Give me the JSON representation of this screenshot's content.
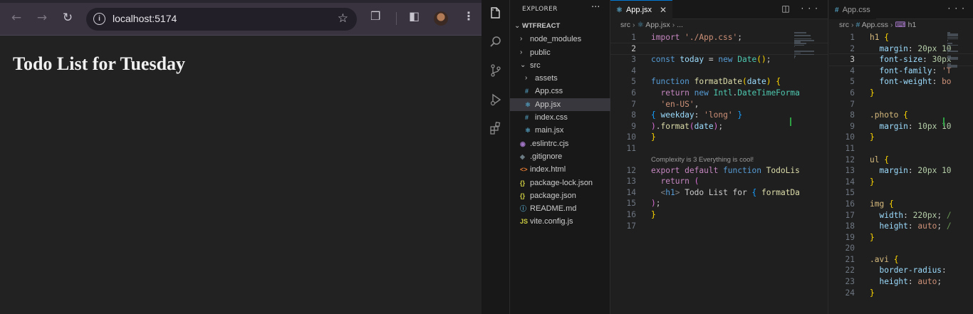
{
  "browser": {
    "url": "localhost:5174",
    "page_heading": "Todo List for Tuesday"
  },
  "vscode": {
    "explorer": {
      "title": "EXPLORER",
      "more": "···",
      "project": "WTFREACT",
      "items": [
        {
          "label": "node_modules",
          "kind": "folder-closed",
          "indent": 1
        },
        {
          "label": "public",
          "kind": "folder-closed",
          "indent": 1
        },
        {
          "label": "src",
          "kind": "folder-open",
          "indent": 1
        },
        {
          "label": "assets",
          "kind": "folder-closed",
          "indent": 2
        },
        {
          "label": "App.css",
          "kind": "css",
          "indent": 2
        },
        {
          "label": "App.jsx",
          "kind": "jsx",
          "indent": 2,
          "selected": true
        },
        {
          "label": "index.css",
          "kind": "css",
          "indent": 2
        },
        {
          "label": "main.jsx",
          "kind": "jsx",
          "indent": 2
        },
        {
          "label": ".eslintrc.cjs",
          "kind": "eslint",
          "indent": 1
        },
        {
          "label": ".gitignore",
          "kind": "git",
          "indent": 1
        },
        {
          "label": "index.html",
          "kind": "html",
          "indent": 1
        },
        {
          "label": "package-lock.json",
          "kind": "json",
          "indent": 1
        },
        {
          "label": "package.json",
          "kind": "json",
          "indent": 1
        },
        {
          "label": "README.md",
          "kind": "info",
          "indent": 1
        },
        {
          "label": "vite.config.js",
          "kind": "js",
          "indent": 1
        }
      ]
    },
    "editor_left": {
      "tab": "App.jsx",
      "breadcrumb": [
        "src",
        "App.jsx",
        "..."
      ],
      "codelens": "Complexity is 3 Everything is cool!",
      "lines": [
        {
          "n": "1",
          "segs": [
            [
              "k-kw",
              "import "
            ],
            [
              "k-str",
              "'./App.css'"
            ],
            [
              "k-plain",
              ";"
            ]
          ]
        },
        {
          "n": "2",
          "segs": [],
          "current": true
        },
        {
          "n": "3",
          "segs": [
            [
              "k-blue",
              "const "
            ],
            [
              "k-var",
              "today"
            ],
            [
              "k-plain",
              " = "
            ],
            [
              "k-blue",
              "new "
            ],
            [
              "k-cls",
              "Date"
            ],
            [
              "k-br1",
              "()"
            ],
            [
              "k-plain",
              ";"
            ]
          ]
        },
        {
          "n": "4",
          "segs": []
        },
        {
          "n": "5",
          "segs": [
            [
              "k-blue",
              "function "
            ],
            [
              "k-fn",
              "formatDate"
            ],
            [
              "k-br1",
              "("
            ],
            [
              "k-var",
              "date"
            ],
            [
              "k-br1",
              ")"
            ],
            [
              "k-plain",
              " "
            ],
            [
              "k-br1",
              "{"
            ]
          ]
        },
        {
          "n": "6",
          "segs": [
            [
              "k-plain",
              "  "
            ],
            [
              "k-kw",
              "return "
            ],
            [
              "k-blue",
              "new "
            ],
            [
              "k-cls",
              "Intl"
            ],
            [
              "k-plain",
              "."
            ],
            [
              "k-cls",
              "DateTimeForma"
            ]
          ]
        },
        {
          "n": "7",
          "segs": [
            [
              "k-plain",
              "  "
            ],
            [
              "k-str",
              "'en-US'"
            ],
            [
              "k-plain",
              ","
            ]
          ]
        },
        {
          "n": "8",
          "segs": [
            [
              "k-br3",
              "{"
            ],
            [
              "k-plain",
              " "
            ],
            [
              "k-var",
              "weekday"
            ],
            [
              "k-plain",
              ": "
            ],
            [
              "k-str",
              "'long'"
            ],
            [
              "k-plain",
              " "
            ],
            [
              "k-br3",
              "}"
            ]
          ]
        },
        {
          "n": "9",
          "segs": [
            [
              "k-br2",
              ")"
            ],
            [
              "k-plain",
              "."
            ],
            [
              "k-fn",
              "format"
            ],
            [
              "k-br2",
              "("
            ],
            [
              "k-var",
              "date"
            ],
            [
              "k-br2",
              ")"
            ],
            [
              "k-plain",
              ";"
            ]
          ]
        },
        {
          "n": "10",
          "segs": [
            [
              "k-br1",
              "}"
            ]
          ]
        },
        {
          "n": "11",
          "segs": []
        },
        {
          "n": "",
          "lens": true
        },
        {
          "n": "12",
          "segs": [
            [
              "k-kw",
              "export "
            ],
            [
              "k-kw",
              "default "
            ],
            [
              "k-blue",
              "function "
            ],
            [
              "k-fn",
              "TodoLis"
            ]
          ]
        },
        {
          "n": "13",
          "segs": [
            [
              "k-plain",
              "  "
            ],
            [
              "k-kw",
              "return "
            ],
            [
              "k-br2",
              "("
            ]
          ]
        },
        {
          "n": "14",
          "segs": [
            [
              "k-plain",
              "  "
            ],
            [
              "k-tag",
              "<"
            ],
            [
              "k-tagn",
              "h1"
            ],
            [
              "k-tag",
              ">"
            ],
            [
              "k-plain",
              " Todo List for "
            ],
            [
              "k-br3",
              "{"
            ],
            [
              "k-plain",
              " "
            ],
            [
              "k-fn",
              "formatDa"
            ]
          ]
        },
        {
          "n": "15",
          "segs": [
            [
              "k-br2",
              ")"
            ],
            [
              "k-plain",
              ";"
            ]
          ]
        },
        {
          "n": "16",
          "segs": [
            [
              "k-br1",
              "}"
            ]
          ]
        },
        {
          "n": "17",
          "segs": []
        }
      ]
    },
    "editor_right": {
      "tab": "App.css",
      "breadcrumb": [
        "src",
        "App.css",
        "h1"
      ],
      "lines": [
        {
          "n": "1",
          "segs": [
            [
              "k-sel",
              "h1 "
            ],
            [
              "k-br1",
              "{"
            ]
          ]
        },
        {
          "n": "2",
          "segs": [
            [
              "k-plain",
              "  "
            ],
            [
              "k-prop",
              "margin"
            ],
            [
              "k-plain",
              ": "
            ],
            [
              "k-num",
              "20px 10"
            ]
          ]
        },
        {
          "n": "3",
          "segs": [
            [
              "k-plain",
              "  "
            ],
            [
              "k-prop",
              "font-size"
            ],
            [
              "k-plain",
              ": "
            ],
            [
              "k-num",
              "30px"
            ]
          ],
          "current": true
        },
        {
          "n": "4",
          "segs": [
            [
              "k-plain",
              "  "
            ],
            [
              "k-prop",
              "font-family"
            ],
            [
              "k-plain",
              ": "
            ],
            [
              "k-str",
              "'T"
            ]
          ]
        },
        {
          "n": "5",
          "segs": [
            [
              "k-plain",
              "  "
            ],
            [
              "k-prop",
              "font-weight"
            ],
            [
              "k-plain",
              ": "
            ],
            [
              "k-str",
              "bo"
            ]
          ]
        },
        {
          "n": "6",
          "segs": [
            [
              "k-br1",
              "}"
            ]
          ]
        },
        {
          "n": "7",
          "segs": []
        },
        {
          "n": "8",
          "segs": [
            [
              "k-sel",
              ".photo "
            ],
            [
              "k-br1",
              "{"
            ]
          ]
        },
        {
          "n": "9",
          "segs": [
            [
              "k-plain",
              "  "
            ],
            [
              "k-prop",
              "margin"
            ],
            [
              "k-plain",
              ": "
            ],
            [
              "k-num",
              "10px 10"
            ]
          ]
        },
        {
          "n": "10",
          "segs": [
            [
              "k-br1",
              "}"
            ]
          ]
        },
        {
          "n": "11",
          "segs": []
        },
        {
          "n": "12",
          "segs": [
            [
              "k-sel",
              "ul "
            ],
            [
              "k-br1",
              "{"
            ]
          ]
        },
        {
          "n": "13",
          "segs": [
            [
              "k-plain",
              "  "
            ],
            [
              "k-prop",
              "margin"
            ],
            [
              "k-plain",
              ": "
            ],
            [
              "k-num",
              "20px 10"
            ]
          ]
        },
        {
          "n": "14",
          "segs": [
            [
              "k-br1",
              "}"
            ]
          ]
        },
        {
          "n": "15",
          "segs": []
        },
        {
          "n": "16",
          "segs": [
            [
              "k-sel",
              "img "
            ],
            [
              "k-br1",
              "{"
            ]
          ]
        },
        {
          "n": "17",
          "segs": [
            [
              "k-plain",
              "  "
            ],
            [
              "k-prop",
              "width"
            ],
            [
              "k-plain",
              ": "
            ],
            [
              "k-num",
              "220px"
            ],
            [
              "k-plain",
              "; "
            ],
            [
              "k-cmt",
              "/"
            ]
          ]
        },
        {
          "n": "18",
          "segs": [
            [
              "k-plain",
              "  "
            ],
            [
              "k-prop",
              "height"
            ],
            [
              "k-plain",
              ": "
            ],
            [
              "k-str",
              "auto"
            ],
            [
              "k-plain",
              "; "
            ],
            [
              "k-cmt",
              "/"
            ]
          ]
        },
        {
          "n": "19",
          "segs": [
            [
              "k-br1",
              "}"
            ]
          ]
        },
        {
          "n": "20",
          "segs": []
        },
        {
          "n": "21",
          "segs": [
            [
              "k-sel",
              ".avi "
            ],
            [
              "k-br1",
              "{"
            ]
          ]
        },
        {
          "n": "22",
          "segs": [
            [
              "k-plain",
              "  "
            ],
            [
              "k-prop",
              "border-radius"
            ],
            [
              "k-plain",
              ":"
            ]
          ]
        },
        {
          "n": "23",
          "segs": [
            [
              "k-plain",
              "  "
            ],
            [
              "k-prop",
              "height"
            ],
            [
              "k-plain",
              ": "
            ],
            [
              "k-str",
              "auto"
            ],
            [
              "k-plain",
              ";"
            ]
          ]
        },
        {
          "n": "24",
          "segs": [
            [
              "k-br1",
              "}"
            ]
          ]
        }
      ]
    }
  },
  "colors": {
    "accent": "#0078d4",
    "css_icon": "#519aba",
    "jsx_icon": "#519aba",
    "json_icon": "#cbcb41",
    "html_icon": "#e37933",
    "js_icon": "#cbcb41",
    "eslint_icon": "#a074c4",
    "git_icon": "#41535b"
  }
}
